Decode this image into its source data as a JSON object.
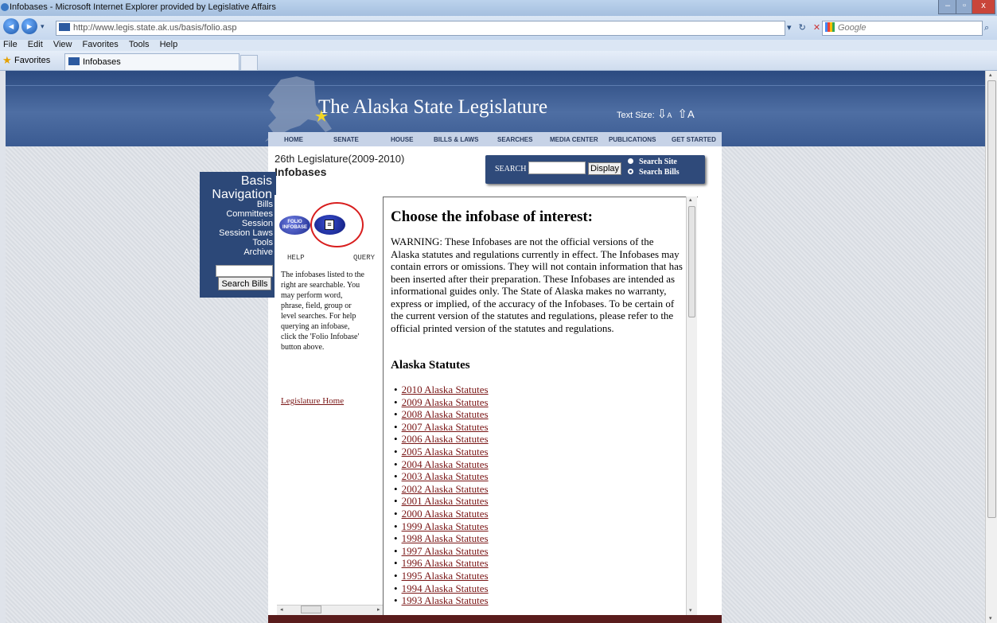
{
  "browser": {
    "window_title": "Infobases - Microsoft Internet Explorer provided by Legislative Affairs",
    "url": "http://www.legis.state.ak.us/basis/folio.asp",
    "search_placeholder": "Google",
    "menu": [
      "File",
      "Edit",
      "View",
      "Favorites",
      "Tools",
      "Help"
    ],
    "favorites_label": "Favorites",
    "tab_label": "Infobases"
  },
  "header": {
    "site_title": "The Alaska State Legislature",
    "text_size_label": "Text Size:",
    "text_size_small": "A",
    "text_size_large": "A",
    "nav": [
      "HOME",
      "SENATE",
      "HOUSE",
      "BILLS & LAWS",
      "SEARCHES",
      "MEDIA CENTER",
      "PUBLICATIONS",
      "GET STARTED"
    ]
  },
  "page": {
    "legislature": "26th Legislature(2009-2010)",
    "title": "Infobases"
  },
  "search": {
    "label": "SEARCH",
    "button": "Display",
    "options": [
      "Search Site",
      "Search Bills"
    ],
    "selected": "Search Bills"
  },
  "basis_nav": {
    "title_line1": "Basis",
    "title_line2": "Navigation",
    "links": [
      "Bills",
      "Committees",
      "Session",
      "Session Laws",
      "Tools",
      "Archive"
    ],
    "button": "Search Bills"
  },
  "left_frame": {
    "folio_logo_text": "FOLIO INFOBASE",
    "help_label": "HELP",
    "query_label": "QUERY",
    "description": "The infobases listed to the right are searchable. You may perform word, phrase, field, group or level searches. For help querying an infobase, click the 'Folio Infobase' button above.",
    "home_link": "Legislature Home"
  },
  "right_frame": {
    "heading": "Choose the infobase of interest:",
    "warning": "WARNING: These Infobases are not the official versions of the Alaska statutes and regulations currently in effect. The Infobases may contain errors or omissions. They will not contain information that has been inserted after their preparation. These Infobases are intended as informational guides only. The State of Alaska makes no warranty, express or implied, of the accuracy of the Infobases. To be certain of the current version of the statutes and regulations, please refer to the official printed version of the statutes and regulations.",
    "subheading": "Alaska Statutes",
    "statutes": [
      "2010 Alaska Statutes",
      "2009 Alaska Statutes",
      "2008 Alaska Statutes",
      "2007 Alaska Statutes",
      "2006 Alaska Statutes",
      "2005 Alaska Statutes",
      "2004 Alaska Statutes",
      "2003 Alaska Statutes",
      "2002 Alaska Statutes",
      "2001 Alaska Statutes",
      "2000 Alaska Statutes",
      "1999 Alaska Statutes",
      "1998 Alaska Statutes",
      "1997 Alaska Statutes",
      "1996 Alaska Statutes",
      "1995 Alaska Statutes",
      "1994 Alaska Statutes",
      "1993 Alaska Statutes"
    ]
  },
  "colors": {
    "banner": "#2b4a80",
    "link": "#7a1616",
    "annotation": "#d81e1e"
  }
}
